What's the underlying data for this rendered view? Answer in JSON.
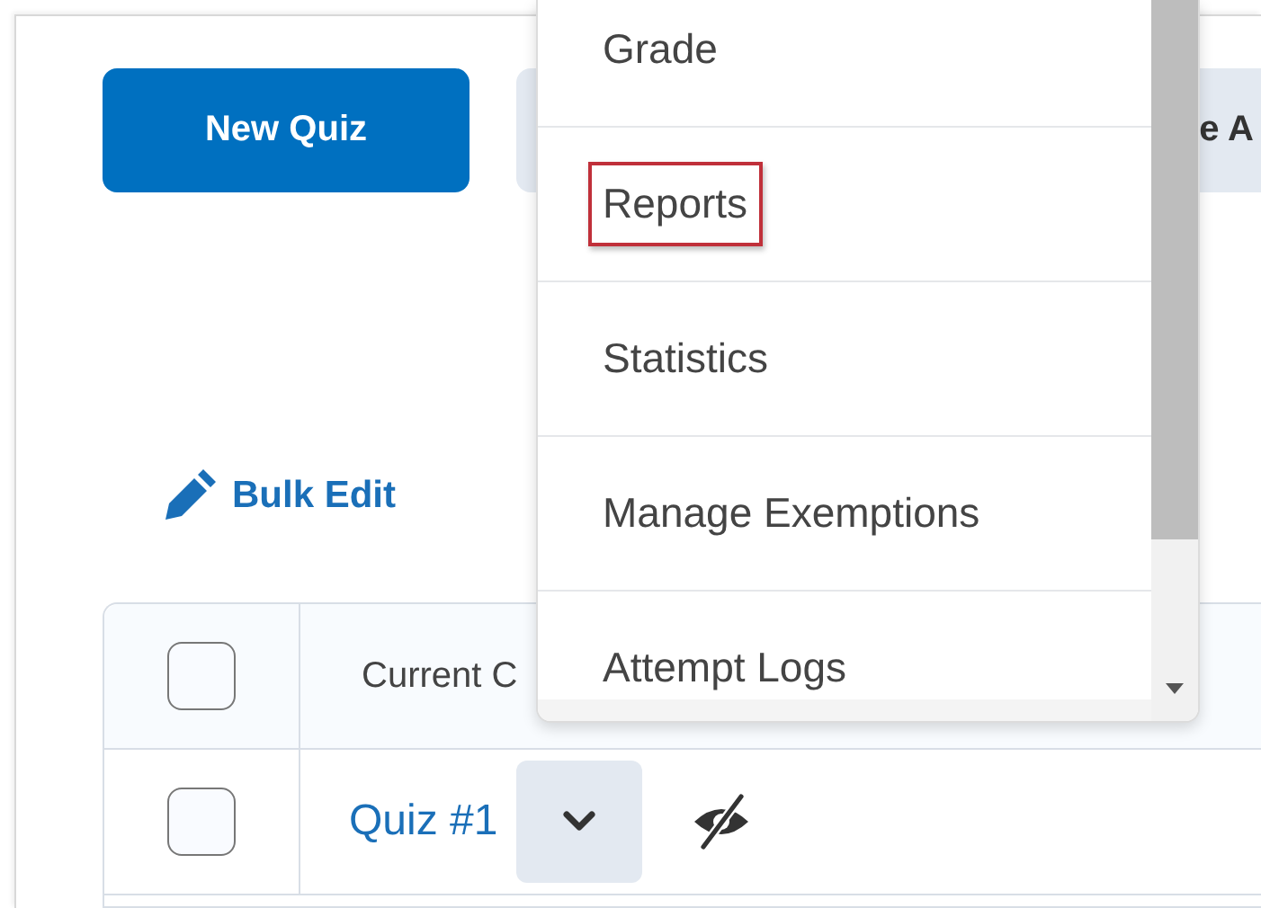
{
  "toolbar": {
    "primary_button": "New Quiz",
    "secondary_button": "e A"
  },
  "bulk_edit": {
    "label": "Bulk Edit"
  },
  "table": {
    "header": {
      "checked": false,
      "column_label": "Current C"
    },
    "rows": [
      {
        "checked": false,
        "title": "Quiz #1"
      }
    ]
  },
  "context_menu": {
    "items": [
      {
        "label": "Grade",
        "highlighted": false
      },
      {
        "label": "Reports",
        "highlighted": true
      },
      {
        "label": "Statistics",
        "highlighted": false
      },
      {
        "label": "Manage Exemptions",
        "highlighted": false
      },
      {
        "label": "Attempt Logs",
        "highlighted": false
      }
    ]
  }
}
